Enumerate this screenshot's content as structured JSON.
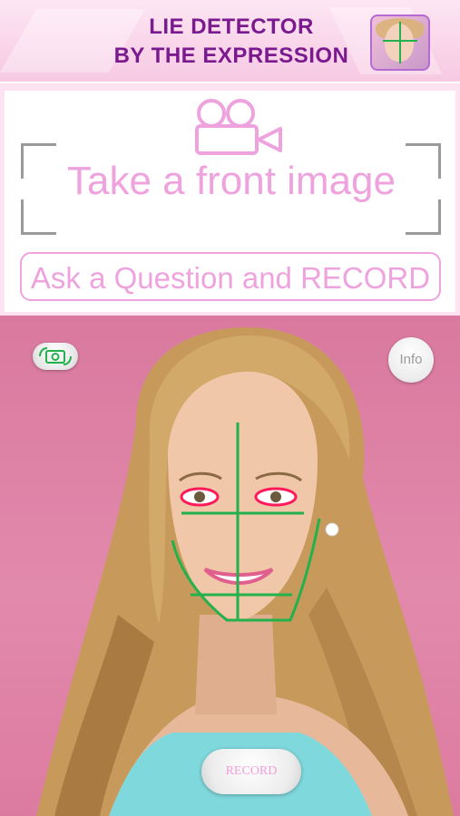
{
  "header": {
    "title_line1": "LIE DETECTOR",
    "title_line2": "BY THE EXPRESSION",
    "app_icon": "face-grid-icon"
  },
  "capture_panel": {
    "camera_icon": "video-camera-icon",
    "instruction": "Take a front image",
    "ask_button_label": "Ask a Question and RECORD"
  },
  "camera_view": {
    "switch_camera_icon": "camera-switch-icon",
    "info_label": "Info",
    "record_label": "RECORD"
  },
  "colors": {
    "title": "#7a1a8e",
    "accent_pink": "#efa3de",
    "overlay_green": "#22b14c",
    "eye_highlight": "#ff1a5a",
    "background_pink": "#e28aac"
  }
}
